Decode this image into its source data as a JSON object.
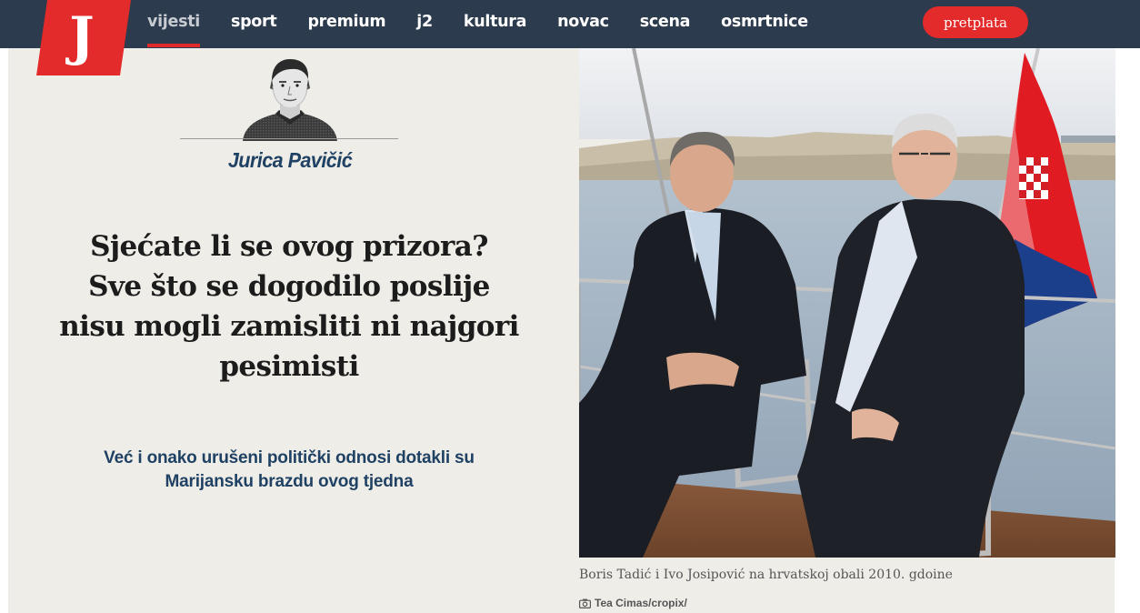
{
  "brand": {
    "logo_letter": "J",
    "logo_color": "#e32b2b"
  },
  "nav": {
    "items": [
      {
        "label": "vijesti",
        "active": true
      },
      {
        "label": "sport"
      },
      {
        "label": "premium"
      },
      {
        "label": "j2"
      },
      {
        "label": "kultura"
      },
      {
        "label": "novac"
      },
      {
        "label": "scena"
      },
      {
        "label": "osmrtnice"
      }
    ],
    "subscribe_label": "pretplata"
  },
  "article": {
    "author": {
      "name": "Jurica Pavičić"
    },
    "headline": "Sjećate li se ovog prizora? Sve što se dogodilo poslije nisu mogli zamisliti ni najgori pesimisti",
    "subtitle": "Već i onako urušeni politički odnosi dotakli su Marijansku brazdu ovog tjedna",
    "image": {
      "caption": "Boris Tadić i Ivo Josipović na hrvatskoj obali 2010. gdoine",
      "credit": "Tea Cimas/cropix/"
    }
  },
  "colors": {
    "topbar": "#2c3b4d",
    "accent_red": "#e32b2b",
    "article_bg": "#efede8",
    "author_blue": "#1f4163"
  }
}
